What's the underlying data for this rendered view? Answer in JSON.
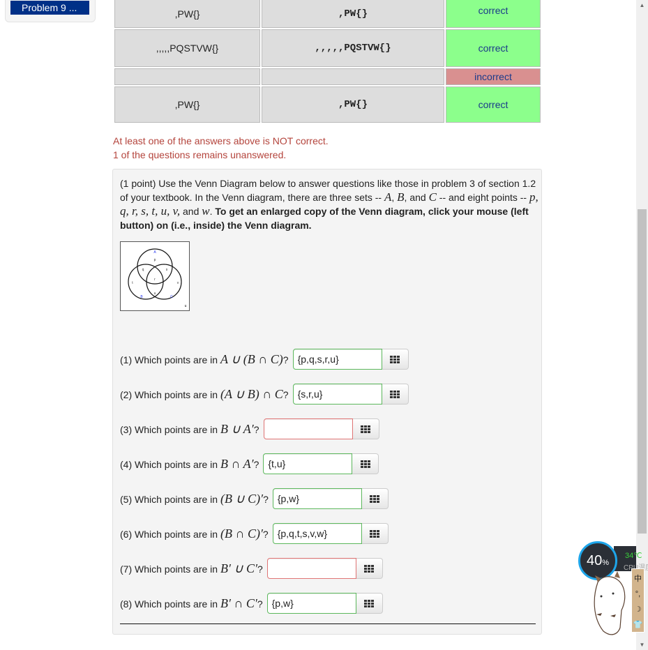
{
  "sidebar": {
    "problem_link": "Problem 9 ..."
  },
  "results_table": {
    "rows": [
      {
        "entered": ",PW{}",
        "preview": ",PW{}",
        "status": "correct",
        "result": "ok"
      },
      {
        "entered": ",,,,,PQSTVW{}",
        "preview": ",,,,,PQSTVW{}",
        "status": "correct",
        "result": "ok"
      },
      {
        "entered": "",
        "preview": "",
        "status": "incorrect",
        "result": "bad"
      },
      {
        "entered": ",PW{}",
        "preview": ",PW{}",
        "status": "correct",
        "result": "ok"
      }
    ]
  },
  "messages": {
    "not_correct": "At least one of the answers above is NOT correct.",
    "unanswered": "1 of the questions remains unanswered."
  },
  "problem": {
    "intro_1": "(1 point) Use the Venn Diagram below to answer questions like those in problem 3 of section 1.2 of your textbook. In the Venn diagram, there are three sets -- ",
    "set_a": "A",
    "sep1": ", ",
    "set_b": "B",
    "sep2": ", and ",
    "set_c": "C",
    "intro_2": " -- and eight points -- ",
    "points": "p, q, r, s, t, u, v,",
    "and_word": " and ",
    "last_point": "w",
    "period": ". ",
    "bold_instruction": "To get an enlarged copy of the Venn diagram, click your mouse (left button) on (i.e., inside) the Venn diagram.",
    "venn": {
      "set_labels": [
        "A",
        "B",
        "C"
      ],
      "point_labels": [
        "p",
        "q",
        "r",
        "s",
        "t",
        "u",
        "v",
        "w"
      ],
      "universe_label": "u"
    },
    "questions": [
      {
        "prefix": "(1) Which points are in ",
        "expr": "A ∪ (B ∩ C)",
        "suffix": "?",
        "answer": "{p,q,s,r,u}",
        "state": "correct"
      },
      {
        "prefix": "(2) Which points are in ",
        "expr": "(A ∪ B) ∩ C",
        "suffix": "?",
        "answer": "{s,r,u}",
        "state": "correct"
      },
      {
        "prefix": "(3) Which points are in ",
        "expr": "B ∪ A′",
        "suffix": "?",
        "answer": "",
        "state": "incorrect"
      },
      {
        "prefix": "(4) Which points are in ",
        "expr": "B ∩ A′",
        "suffix": "?",
        "answer": "{t,u}",
        "state": "correct"
      },
      {
        "prefix": "(5) Which points are in ",
        "expr": "(B ∪ C)′",
        "suffix": "?",
        "answer": "{p,w}",
        "state": "correct"
      },
      {
        "prefix": "(6) Which points are in ",
        "expr": "(B ∩ C)′",
        "suffix": "?",
        "answer": "{p,q,t,s,v,w}",
        "state": "correct"
      },
      {
        "prefix": "(7) Which points are in ",
        "expr": "B′ ∪ C′",
        "suffix": "?",
        "answer": "",
        "state": "incorrect"
      },
      {
        "prefix": "(8) Which points are in ",
        "expr": "B′ ∩ C′",
        "suffix": "?",
        "answer": "{p,w}",
        "state": "correct"
      }
    ]
  },
  "system_widget": {
    "cpu_percent": "40",
    "percent_sign": "%",
    "temperature": "34℃",
    "cpu_label": "CPU温度",
    "ime_items": [
      "中",
      "°,",
      "☽",
      "👕"
    ]
  },
  "colors": {
    "correct_bg": "#8cff8c",
    "incorrect_bg": "#d99090",
    "message": "#b4443c",
    "nav_blue": "#003087"
  }
}
